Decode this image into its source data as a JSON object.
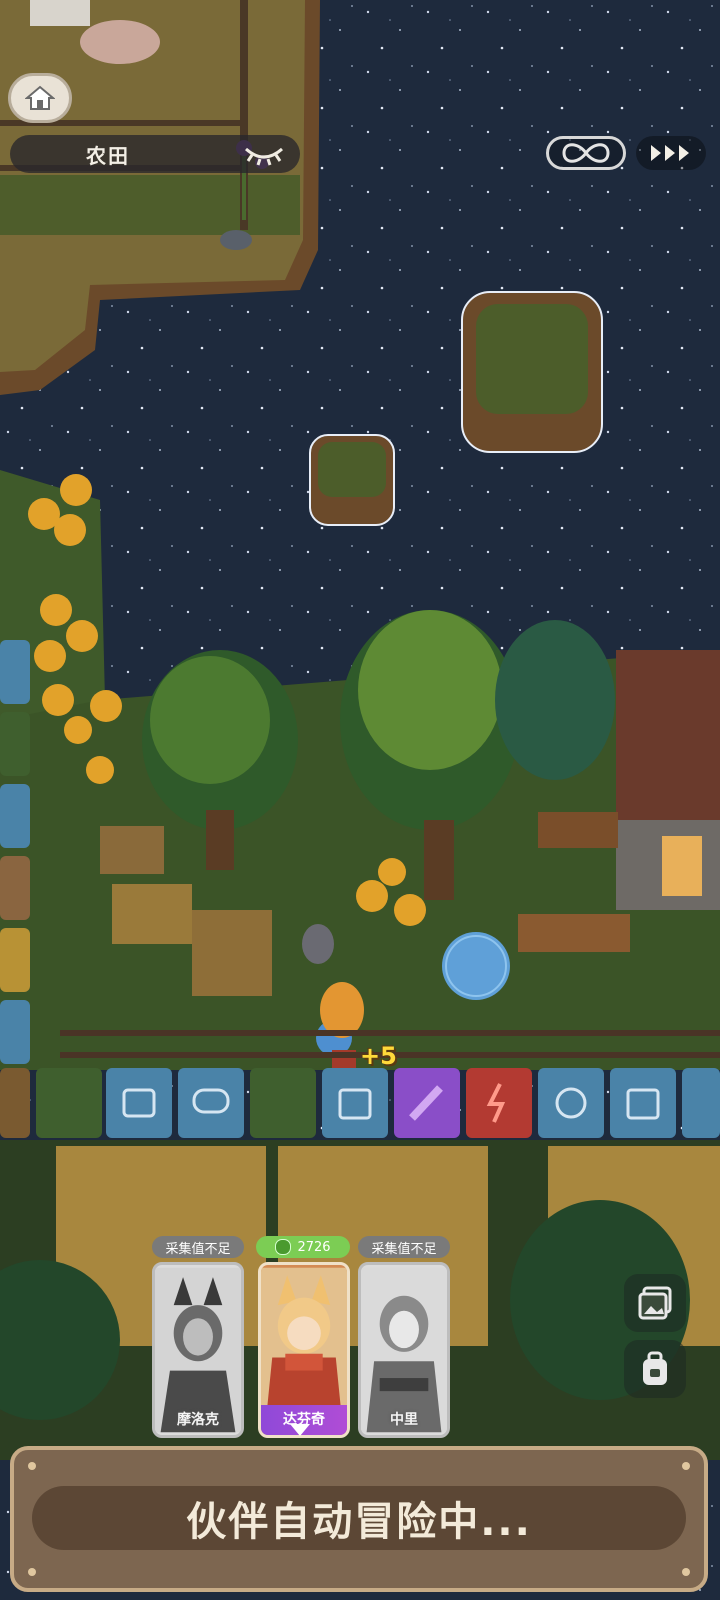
{
  "location": {
    "name": "农田"
  },
  "float_reward": "+5",
  "companions": [
    {
      "name": "摩洛克",
      "status": "采集值不足",
      "state": "insufficient"
    },
    {
      "name": "达芬奇",
      "status": "2726",
      "state": "active"
    },
    {
      "name": "中里",
      "status": "采集值不足",
      "state": "insufficient"
    }
  ],
  "banner": {
    "text": "伙伴自动冒险中..."
  },
  "colors": {
    "lake": "#1e2a3d",
    "grass": "#3f5a2a",
    "dirt": "#6b4a2a",
    "active_badge": "#7ccd54",
    "card_name_band": "#9b4bd8",
    "banner": "#7d6650"
  },
  "icons": [
    "home-icon",
    "eye-closed-icon",
    "infinity-icon",
    "fast-forward-icon",
    "gallery-icon",
    "backpack-icon"
  ]
}
